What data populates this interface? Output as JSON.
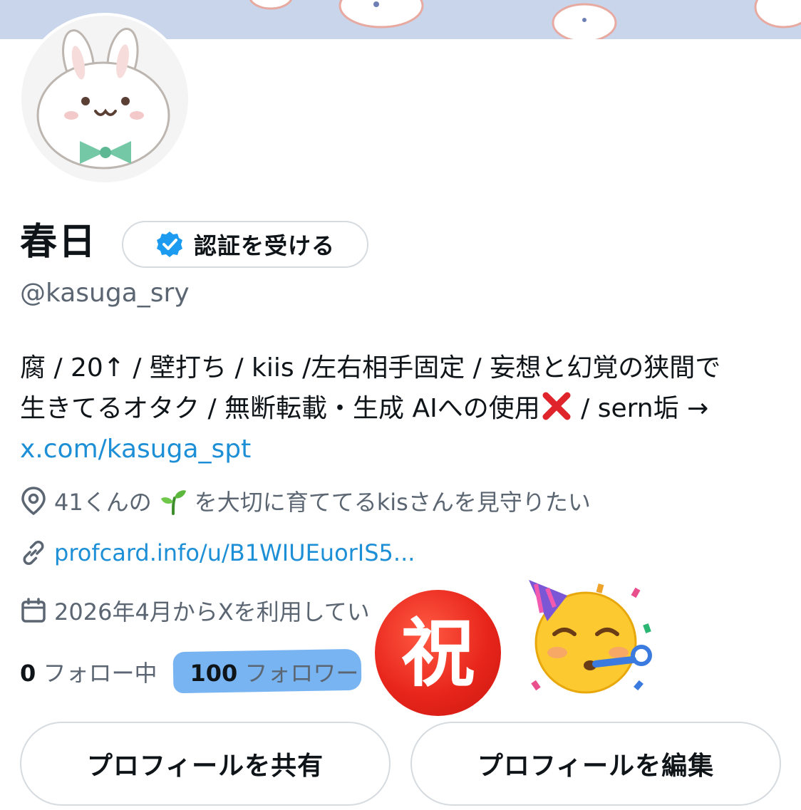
{
  "profile": {
    "display_name": "春日",
    "verify_label": "認証を受ける",
    "handle": "@kasuga_sry",
    "bio_lines": [
      "腐 / 20↑ / 壁打ち / kiis /左右相手固定 / 妄想と幻覚の狭間で",
      "生きてるオタク / 無断転載・生成 AIへの使用",
      " / sern垢 →"
    ],
    "bio_link": "x.com/kasuga_spt",
    "location_prefix": "41くんの",
    "location_suffix": "を大切に育ててるkisさんを見守りたい",
    "website": "profcard.info/u/B1WIUEuorIS5...",
    "joined": "2026年4月からXを利用してい",
    "following_count": "0",
    "following_label": "フォロー中",
    "followers_count": "100",
    "followers_label": "フォロワー"
  },
  "overlay": {
    "stamp_text": "祝"
  },
  "actions": {
    "share_label": "プロフィールを共有",
    "edit_label": "プロフィールを編集"
  },
  "icons": {
    "verified": "verified-badge-icon",
    "location": "location-pin-icon",
    "link": "link-icon",
    "calendar": "calendar-icon",
    "sprout": "sprout-emoji",
    "cross": "cross-mark-emoji",
    "party": "partying-face-emoji"
  },
  "colors": {
    "accent": "#1d8fd6",
    "verified": "#1d9bf0",
    "muted": "#5b6672",
    "highlight": "#69acf0",
    "stamp": "#e8261b"
  }
}
